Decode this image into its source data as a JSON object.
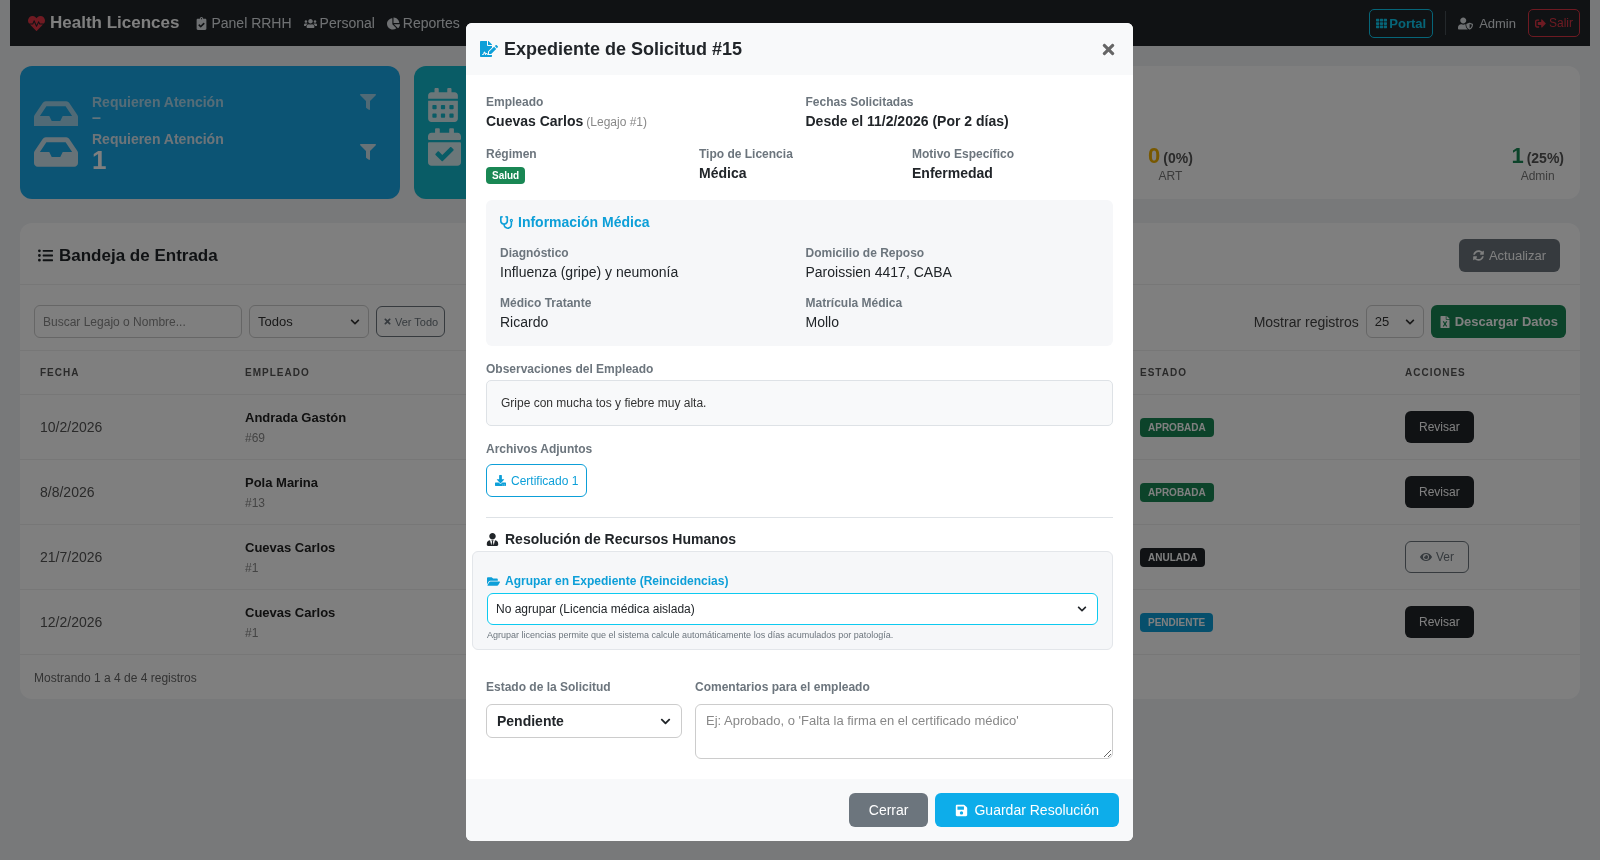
{
  "navbar": {
    "brand": "Health Licences",
    "links": [
      "Panel RRHH",
      "Personal",
      "Reportes"
    ],
    "portal": "Portal",
    "user": "Admin",
    "logout": "Salir"
  },
  "stats": {
    "attention": [
      {
        "label": "Requieren Atención",
        "value": "–",
        "kind": "ghost"
      },
      {
        "label": "Requieren Atención",
        "value": "1",
        "kind": "main"
      }
    ],
    "breakdown": [
      {
        "value": "0",
        "percent": "(0%)",
        "label": "ART",
        "kind": "warning"
      },
      {
        "value": "1",
        "percent": "(25%)",
        "label": "Admin",
        "kind": "success"
      }
    ]
  },
  "inbox": {
    "title": "Bandeja de Entrada",
    "refresh": "Actualizar",
    "search": {
      "placeholder": "Buscar Legajo o Nombre..."
    },
    "filter": "Todos",
    "clear": "Ver Todo",
    "page_size_label": "Mostrar registros",
    "page_size": "25",
    "download": "Descargar Datos",
    "columns": [
      "FECHA",
      "EMPLEADO",
      "ESTADO",
      "ACCIONES"
    ],
    "rows": [
      {
        "date": "10/2/2026",
        "name": "Andrada Gastón",
        "legajo": "#69",
        "status": {
          "label": "APROBADA",
          "kind": "approved"
        },
        "action": {
          "label": "Revisar",
          "kind": "review"
        }
      },
      {
        "date": "8/8/2026",
        "name": "Pola Marina",
        "legajo": "#13",
        "status": {
          "label": "APROBADA",
          "kind": "approved"
        },
        "action": {
          "label": "Revisar",
          "kind": "review"
        }
      },
      {
        "date": "21/7/2026",
        "name": "Cuevas Carlos",
        "legajo": "#1",
        "status": {
          "label": "ANULADA",
          "kind": "voided"
        },
        "action": {
          "label": "Ver",
          "kind": "view"
        }
      },
      {
        "date": "12/2/2026",
        "name": "Cuevas Carlos",
        "legajo": "#1",
        "status": {
          "label": "PENDIENTE",
          "kind": "pending"
        },
        "action": {
          "label": "Revisar",
          "kind": "review"
        }
      }
    ],
    "footer": "Mostrando 1 a 4 de 4 registros"
  },
  "modal": {
    "title": "Expediente de Solicitud #15",
    "employee": {
      "label": "Empleado",
      "name": "Cuevas Carlos",
      "legajo": "(Legajo #1)"
    },
    "dates": {
      "label": "Fechas Solicitadas",
      "value": "Desde el 11/2/2026 (Por 2 días)"
    },
    "regime": {
      "label": "Régimen",
      "value": "Salud"
    },
    "details": [
      {
        "label": "Tipo de Licencia",
        "value": "Médica"
      },
      {
        "label": "Motivo Específico",
        "value": "Enfermedad"
      }
    ],
    "medical": {
      "title": "Información Médica",
      "fields": [
        {
          "label": "Diagnóstico",
          "value": "Influenza (gripe) y neumonía"
        },
        {
          "label": "Domicilio de Reposo",
          "value": "Paroissien 4417, CABA"
        },
        {
          "label": "Médico Tratante",
          "value": "Ricardo"
        },
        {
          "label": "Matrícula Médica",
          "value": "Mollo"
        }
      ]
    },
    "observations": {
      "label": "Observaciones del Empleado",
      "value": "Gripe con mucha tos y fiebre muy alta."
    },
    "attachments": {
      "label": "Archivos Adjuntos",
      "files": [
        "Certificado 1"
      ]
    },
    "resolution": {
      "title": "Resolución de Recursos Humanos",
      "group_label": "Agrupar en Expediente (Reincidencias)",
      "group_value": "No agrupar (Licencia médica aislada)",
      "group_help": "Agrupar licencias permite que el sistema calcule automáticamente los días acumulados por patología.",
      "status_label": "Estado de la Solicitud",
      "status_value": "Pendiente",
      "comments_label": "Comentarios para el empleado",
      "comments_placeholder": "Ej: Aprobado, o 'Falta la firma en el certificado médico'"
    },
    "close": "Cerrar",
    "save": "Guardar Resolución"
  }
}
